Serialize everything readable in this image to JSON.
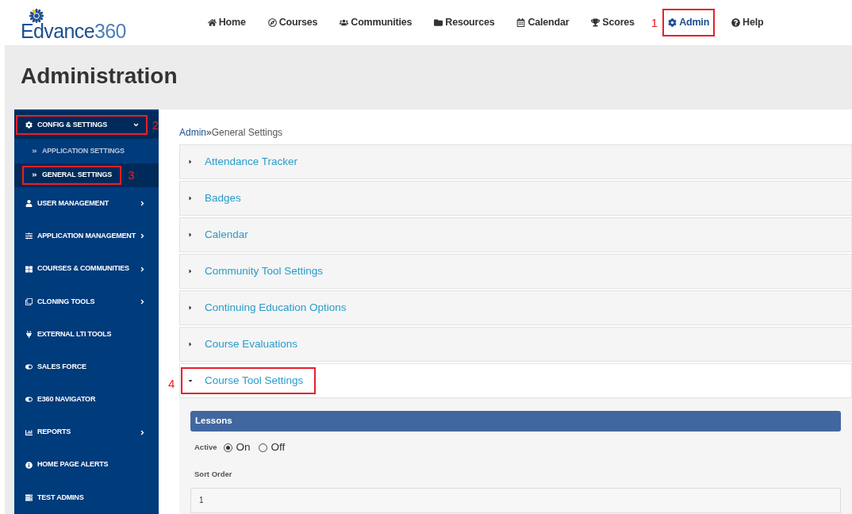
{
  "logo": {
    "name": "Edvance",
    "suffix": "360"
  },
  "nav": [
    {
      "label": "Home",
      "highlighted": false
    },
    {
      "label": "Courses",
      "highlighted": false
    },
    {
      "label": "Communities",
      "highlighted": false
    },
    {
      "label": "Resources",
      "highlighted": false
    },
    {
      "label": "Calendar",
      "highlighted": false
    },
    {
      "label": "Scores",
      "highlighted": false
    },
    {
      "label": "Admin",
      "highlighted": true,
      "selected": true,
      "callout": "1"
    },
    {
      "label": "Help",
      "highlighted": false
    }
  ],
  "page_title": "Administration",
  "sidebar": {
    "items": [
      {
        "label": "CONFIG & SETTINGS",
        "expanded": true,
        "highlighted": true,
        "callout": "2",
        "children": [
          {
            "label": "APPLICATION SETTINGS",
            "selected": false,
            "highlighted": false
          },
          {
            "label": "GENERAL SETTINGS",
            "selected": true,
            "highlighted": true,
            "callout": "3"
          }
        ]
      },
      {
        "label": "USER MANAGEMENT",
        "expanded": false,
        "highlighted": false
      },
      {
        "label": "APPLICATION MANAGEMENT",
        "expanded": false,
        "highlighted": false
      },
      {
        "label": "COURSES & COMMUNITIES",
        "expanded": false,
        "highlighted": false
      },
      {
        "label": "CLONING TOOLS",
        "expanded": false,
        "highlighted": false
      },
      {
        "label": "EXTERNAL LTI TOOLS",
        "highlighted": false
      },
      {
        "label": "SALES FORCE",
        "highlighted": false
      },
      {
        "label": "E360 NAVIGATOR",
        "highlighted": false
      },
      {
        "label": "REPORTS",
        "expanded": false,
        "highlighted": false
      },
      {
        "label": "HOME PAGE ALERTS",
        "highlighted": false
      },
      {
        "label": "TEST ADMINS",
        "highlighted": false
      }
    ]
  },
  "breadcrumb": {
    "link": "Admin",
    "separator": "»",
    "current": "General Settings"
  },
  "sections": [
    {
      "title": "Attendance Tracker",
      "expanded": false,
      "highlighted": false
    },
    {
      "title": "Badges",
      "expanded": false,
      "highlighted": false
    },
    {
      "title": "Calendar",
      "expanded": false,
      "highlighted": false
    },
    {
      "title": "Community Tool Settings",
      "expanded": false,
      "highlighted": false
    },
    {
      "title": "Continuing Education Options",
      "expanded": false,
      "highlighted": false
    },
    {
      "title": "Course Evaluations",
      "expanded": false,
      "highlighted": false
    },
    {
      "title": "Course Tool Settings",
      "expanded": true,
      "highlighted": true,
      "callout": "4",
      "panel": {
        "heading": "Lessons",
        "active_label": "Active",
        "options": [
          {
            "label": "On",
            "selected": true
          },
          {
            "label": "Off",
            "selected": false
          }
        ],
        "sort_label": "Sort Order",
        "sort_value": "1"
      }
    }
  ]
}
